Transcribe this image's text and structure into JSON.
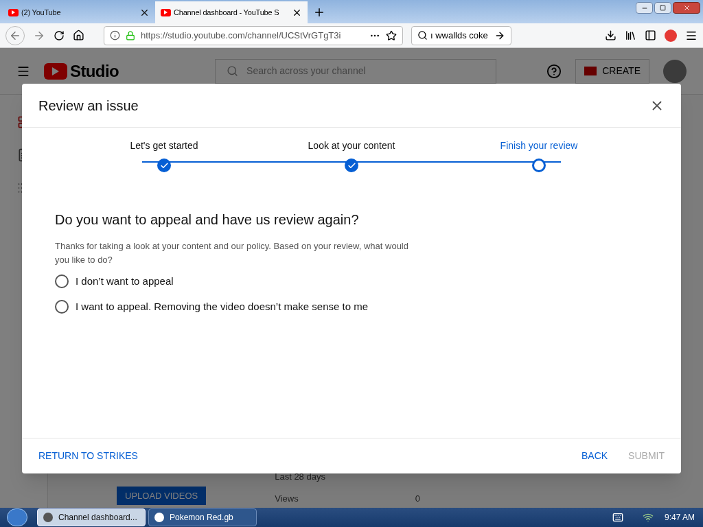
{
  "browser": {
    "tabs": [
      {
        "title": "(2) YouTube",
        "selected": false
      },
      {
        "title": "Channel dashboard - YouTube S",
        "selected": true
      }
    ],
    "url": "https://studio.youtube.com/channel/UCStVrGTgT3i",
    "search_value": "ı wwallds coke"
  },
  "studio": {
    "logo": "Studio",
    "search_placeholder": "Search across your channel",
    "create": "CREATE",
    "behind": {
      "period": "Last 28 days",
      "upload": "UPLOAD VIDEOS",
      "views_label": "Views",
      "views_value": "0"
    }
  },
  "dialog": {
    "title": "Review an issue",
    "steps": [
      {
        "label": "Let's get started",
        "completed": true,
        "selected": false
      },
      {
        "label": "Look at your content",
        "completed": true,
        "selected": false
      },
      {
        "label": "Finish your review",
        "completed": false,
        "selected": true
      }
    ],
    "question": "Do you want to appeal and have us review again?",
    "description": "Thanks for taking a look at your content and our policy. Based on your review, what would you like to do?",
    "options": [
      {
        "label": "I don’t want to appeal",
        "selected": false
      },
      {
        "label": "I want to appeal. Removing the video doesn’t make sense to me",
        "selected": false
      }
    ],
    "footer": {
      "return": "RETURN TO STRIKES",
      "back": "BACK",
      "submit": {
        "label": "SUBMIT",
        "disabled": true
      }
    }
  },
  "taskbar": {
    "items": [
      {
        "label": "Channel dashboard...",
        "selected": true
      },
      {
        "label": "Pokemon Red.gb",
        "selected": false
      }
    ],
    "time": "9:47 AM"
  }
}
